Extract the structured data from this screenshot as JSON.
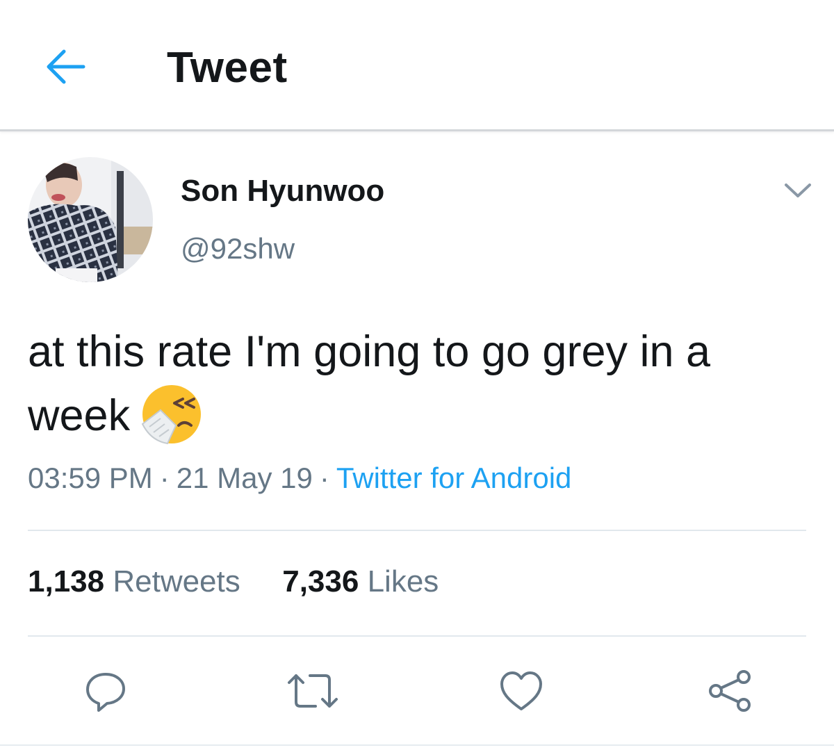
{
  "header": {
    "title": "Tweet",
    "back_icon": "arrow-left-icon",
    "accent_color": "#1da1f2"
  },
  "tweet": {
    "author": {
      "name": "Son Hyunwoo",
      "handle": "@92shw"
    },
    "text": "at this rate I'm going to go grey in a week",
    "emoji": "sneezing-face-icon",
    "time": "03:59 PM",
    "separator": "·",
    "date": "21 May 19",
    "source": "Twitter for Android",
    "stats": {
      "retweets_count": "1,138",
      "retweets_label": "Retweets",
      "likes_count": "7,336",
      "likes_label": "Likes"
    },
    "actions": [
      "reply-icon",
      "retweet-icon",
      "like-icon",
      "share-icon"
    ]
  },
  "colors": {
    "text_primary": "#14171a",
    "text_secondary": "#657786",
    "link": "#1da1f2",
    "divider": "#e1e8ed"
  }
}
